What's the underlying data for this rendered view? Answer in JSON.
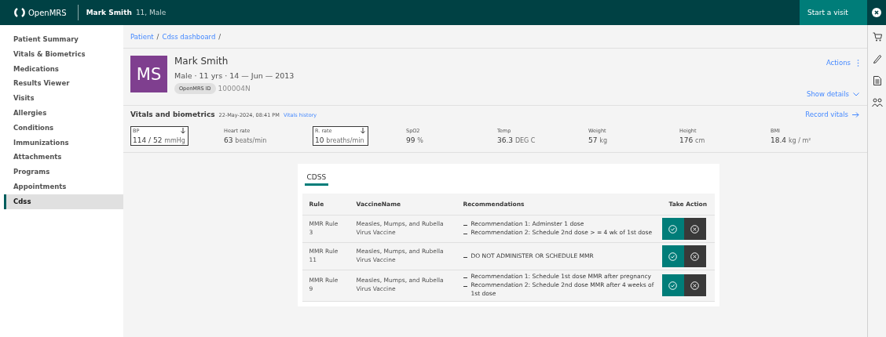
{
  "header": {
    "brand": "OpenMRS",
    "patient_name": "Mark Smith",
    "patient_info": "11, Male",
    "start_visit": "Start a visit"
  },
  "sidebar": {
    "items": [
      {
        "label": "Patient Summary",
        "selected": false
      },
      {
        "label": "Vitals & Biometrics",
        "selected": false
      },
      {
        "label": "Medications",
        "selected": false
      },
      {
        "label": "Results Viewer",
        "selected": false
      },
      {
        "label": "Visits",
        "selected": false
      },
      {
        "label": "Allergies",
        "selected": false
      },
      {
        "label": "Conditions",
        "selected": false
      },
      {
        "label": "Immunizations",
        "selected": false
      },
      {
        "label": "Attachments",
        "selected": false
      },
      {
        "label": "Programs",
        "selected": false
      },
      {
        "label": "Appointments",
        "selected": false
      },
      {
        "label": "Cdss",
        "selected": true
      }
    ]
  },
  "breadcrumbs": [
    {
      "label": "Patient",
      "separator": "/"
    },
    {
      "label": "Cdss dashboard",
      "separator": "/"
    }
  ],
  "patient": {
    "initials": "MS",
    "name": "Mark Smith",
    "details": "Male · 11 yrs · 14 — Jun — 2013",
    "id_label": "OpenMRS ID",
    "id_value": "100004N",
    "actions": "Actions",
    "show_details": "Show details"
  },
  "vitals": {
    "title": "Vitals and biometrics",
    "timestamp": "22-May-2024, 08:41 PM",
    "history_link": "Vitals history",
    "record_link": "Record vitals",
    "items": [
      {
        "label": "BP",
        "value": "114 / 52",
        "unit": "mmHg",
        "flagged": true
      },
      {
        "label": "Heart rate",
        "value": "63",
        "unit": "beats/min",
        "flagged": false
      },
      {
        "label": "R. rate",
        "value": "10",
        "unit": "breaths/min",
        "flagged": true
      },
      {
        "label": "SpO2",
        "value": "99",
        "unit": "%",
        "flagged": false
      },
      {
        "label": "Temp",
        "value": "36.3",
        "unit": "DEG C",
        "flagged": false
      },
      {
        "label": "Weight",
        "value": "57",
        "unit": "kg",
        "flagged": false
      },
      {
        "label": "Height",
        "value": "176",
        "unit": "cm",
        "flagged": false
      },
      {
        "label": "BMI",
        "value": "18.4",
        "unit": "kg / m²",
        "flagged": false
      }
    ]
  },
  "cdss": {
    "tab": "CDSS",
    "table": {
      "columns": [
        "Rule",
        "VaccineName",
        "Recommendations",
        "Take Action"
      ],
      "rows": [
        {
          "rule": "MMR Rule 3",
          "vaccine": "Measles, Mumps, and Rubella Virus Vaccine",
          "recommendations": [
            "Recommendation 1: Adminster 1 dose",
            "Recommendation 2: Schedule 2nd dose > = 4 wk of 1st dose"
          ]
        },
        {
          "rule": "MMR Rule 11",
          "vaccine": "Measles, Mumps, and Rubella Virus Vaccine",
          "recommendations": [
            "DO NOT ADMINISTER OR SCHEDULE MMR"
          ]
        },
        {
          "rule": "MMR Rule 9",
          "vaccine": "Measles, Mumps, and Rubella Virus Vaccine",
          "recommendations": [
            "Recommendation 1: Schedule 1st dose MMR after pregnancy",
            "Recommendation 2: Schedule 2nd dose MMR after 4 weeks of 1st dose"
          ]
        }
      ]
    }
  }
}
